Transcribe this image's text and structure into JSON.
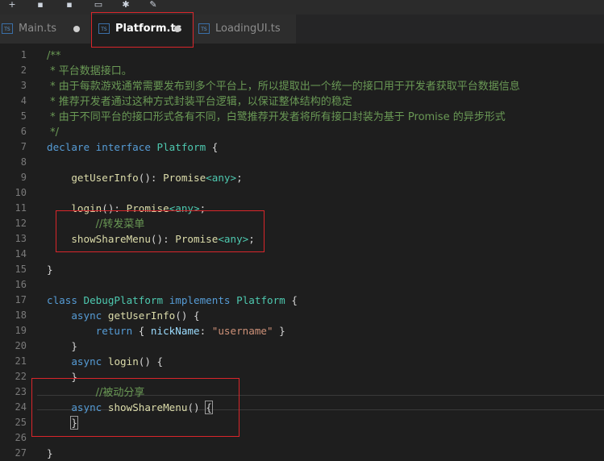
{
  "toolbar": {
    "icons": [
      "add-file-icon",
      "save-icon",
      "save-all-icon",
      "keyboard-icon",
      "settings-icon",
      "brush-icon"
    ],
    "glyphs": [
      "+",
      "▪",
      "▪",
      "▭",
      "✱",
      "✎"
    ]
  },
  "tabs": [
    {
      "label": "Main.ts",
      "icon_text": "TS",
      "active": false
    },
    {
      "label": "Platform.ts",
      "icon_text": "TS",
      "active": true
    },
    {
      "label": "LoadingUI.ts",
      "icon_text": "TS",
      "active": false
    }
  ],
  "editor": {
    "line_numbers": [
      "1",
      "2",
      "3",
      "4",
      "5",
      "6",
      "7",
      "8",
      "9",
      "10",
      "11",
      "12",
      "13",
      "14",
      "15",
      "16",
      "17",
      "18",
      "19",
      "20",
      "21",
      "22",
      "23",
      "24",
      "25",
      "26",
      "27"
    ],
    "lines": [
      [
        [
          "cmt",
          "/**"
        ]
      ],
      [
        [
          "cmt",
          " * 平台数据接口。"
        ]
      ],
      [
        [
          "cmt",
          " * 由于每款游戏通常需要发布到多个平台上，所以提取出一个统一的接口用于开发者获取平台数据信息"
        ]
      ],
      [
        [
          "cmt",
          " * 推荐开发者通过这种方式封装平台逻辑，以保证整体结构的稳定"
        ]
      ],
      [
        [
          "cmt",
          " * 由于不同平台的接口形式各有不同，白鹭推荐开发者将所有接口封装为基于 Promise 的异步形式"
        ]
      ],
      [
        [
          "cmt",
          " */"
        ]
      ],
      [
        [
          "kw",
          "declare"
        ],
        [
          "pu",
          " "
        ],
        [
          "kw",
          "interface"
        ],
        [
          "pu",
          " "
        ],
        [
          "ty",
          "Platform"
        ],
        [
          "pu",
          " {"
        ]
      ],
      [],
      [
        [
          "pu",
          "    "
        ],
        [
          "fn",
          "getUserInfo"
        ],
        [
          "pu",
          "(): "
        ],
        [
          "fn",
          "Promise"
        ],
        [
          "ty",
          "<any>"
        ],
        [
          "pu",
          ";"
        ]
      ],
      [],
      [
        [
          "pu",
          "    "
        ],
        [
          "fn",
          "login"
        ],
        [
          "pu",
          "(): "
        ],
        [
          "fn",
          "Promise"
        ],
        [
          "ty",
          "<any>"
        ],
        [
          "pu",
          ";"
        ]
      ],
      [
        [
          "pu",
          "        "
        ],
        [
          "cmt",
          "//转发菜单"
        ]
      ],
      [
        [
          "pu",
          "    "
        ],
        [
          "fn",
          "showShareMenu"
        ],
        [
          "pu",
          "(): "
        ],
        [
          "fn",
          "Promise"
        ],
        [
          "ty",
          "<any>"
        ],
        [
          "pu",
          ";"
        ]
      ],
      [],
      [
        [
          "pu",
          "}"
        ]
      ],
      [],
      [
        [
          "kw",
          "class"
        ],
        [
          "pu",
          " "
        ],
        [
          "ty",
          "DebugPlatform"
        ],
        [
          "pu",
          " "
        ],
        [
          "kw",
          "implements"
        ],
        [
          "pu",
          " "
        ],
        [
          "ty",
          "Platform"
        ],
        [
          "pu",
          " {"
        ]
      ],
      [
        [
          "pu",
          "    "
        ],
        [
          "kw",
          "async"
        ],
        [
          "pu",
          " "
        ],
        [
          "fn",
          "getUserInfo"
        ],
        [
          "pu",
          "() {"
        ]
      ],
      [
        [
          "pu",
          "        "
        ],
        [
          "kw",
          "return"
        ],
        [
          "pu",
          " { "
        ],
        [
          "pr",
          "nickName"
        ],
        [
          "pu",
          ": "
        ],
        [
          "st",
          "\"username\""
        ],
        [
          "pu",
          " }"
        ]
      ],
      [
        [
          "pu",
          "    }"
        ]
      ],
      [
        [
          "pu",
          "    "
        ],
        [
          "kw",
          "async"
        ],
        [
          "pu",
          " "
        ],
        [
          "fn",
          "login"
        ],
        [
          "pu",
          "() {"
        ]
      ],
      [
        [
          "pu",
          "    }"
        ]
      ],
      [
        [
          "pu",
          "        "
        ],
        [
          "cmt",
          "//被动分享"
        ]
      ],
      [
        [
          "pu",
          "    "
        ],
        [
          "kw",
          "async"
        ],
        [
          "pu",
          " "
        ],
        [
          "fn",
          "showShareMenu"
        ],
        [
          "pu",
          "() "
        ],
        [
          "bx",
          "{"
        ]
      ],
      [
        [
          "pu",
          "    "
        ],
        [
          "bx",
          "}"
        ]
      ],
      [],
      [
        [
          "pu",
          "}"
        ]
      ]
    ]
  }
}
